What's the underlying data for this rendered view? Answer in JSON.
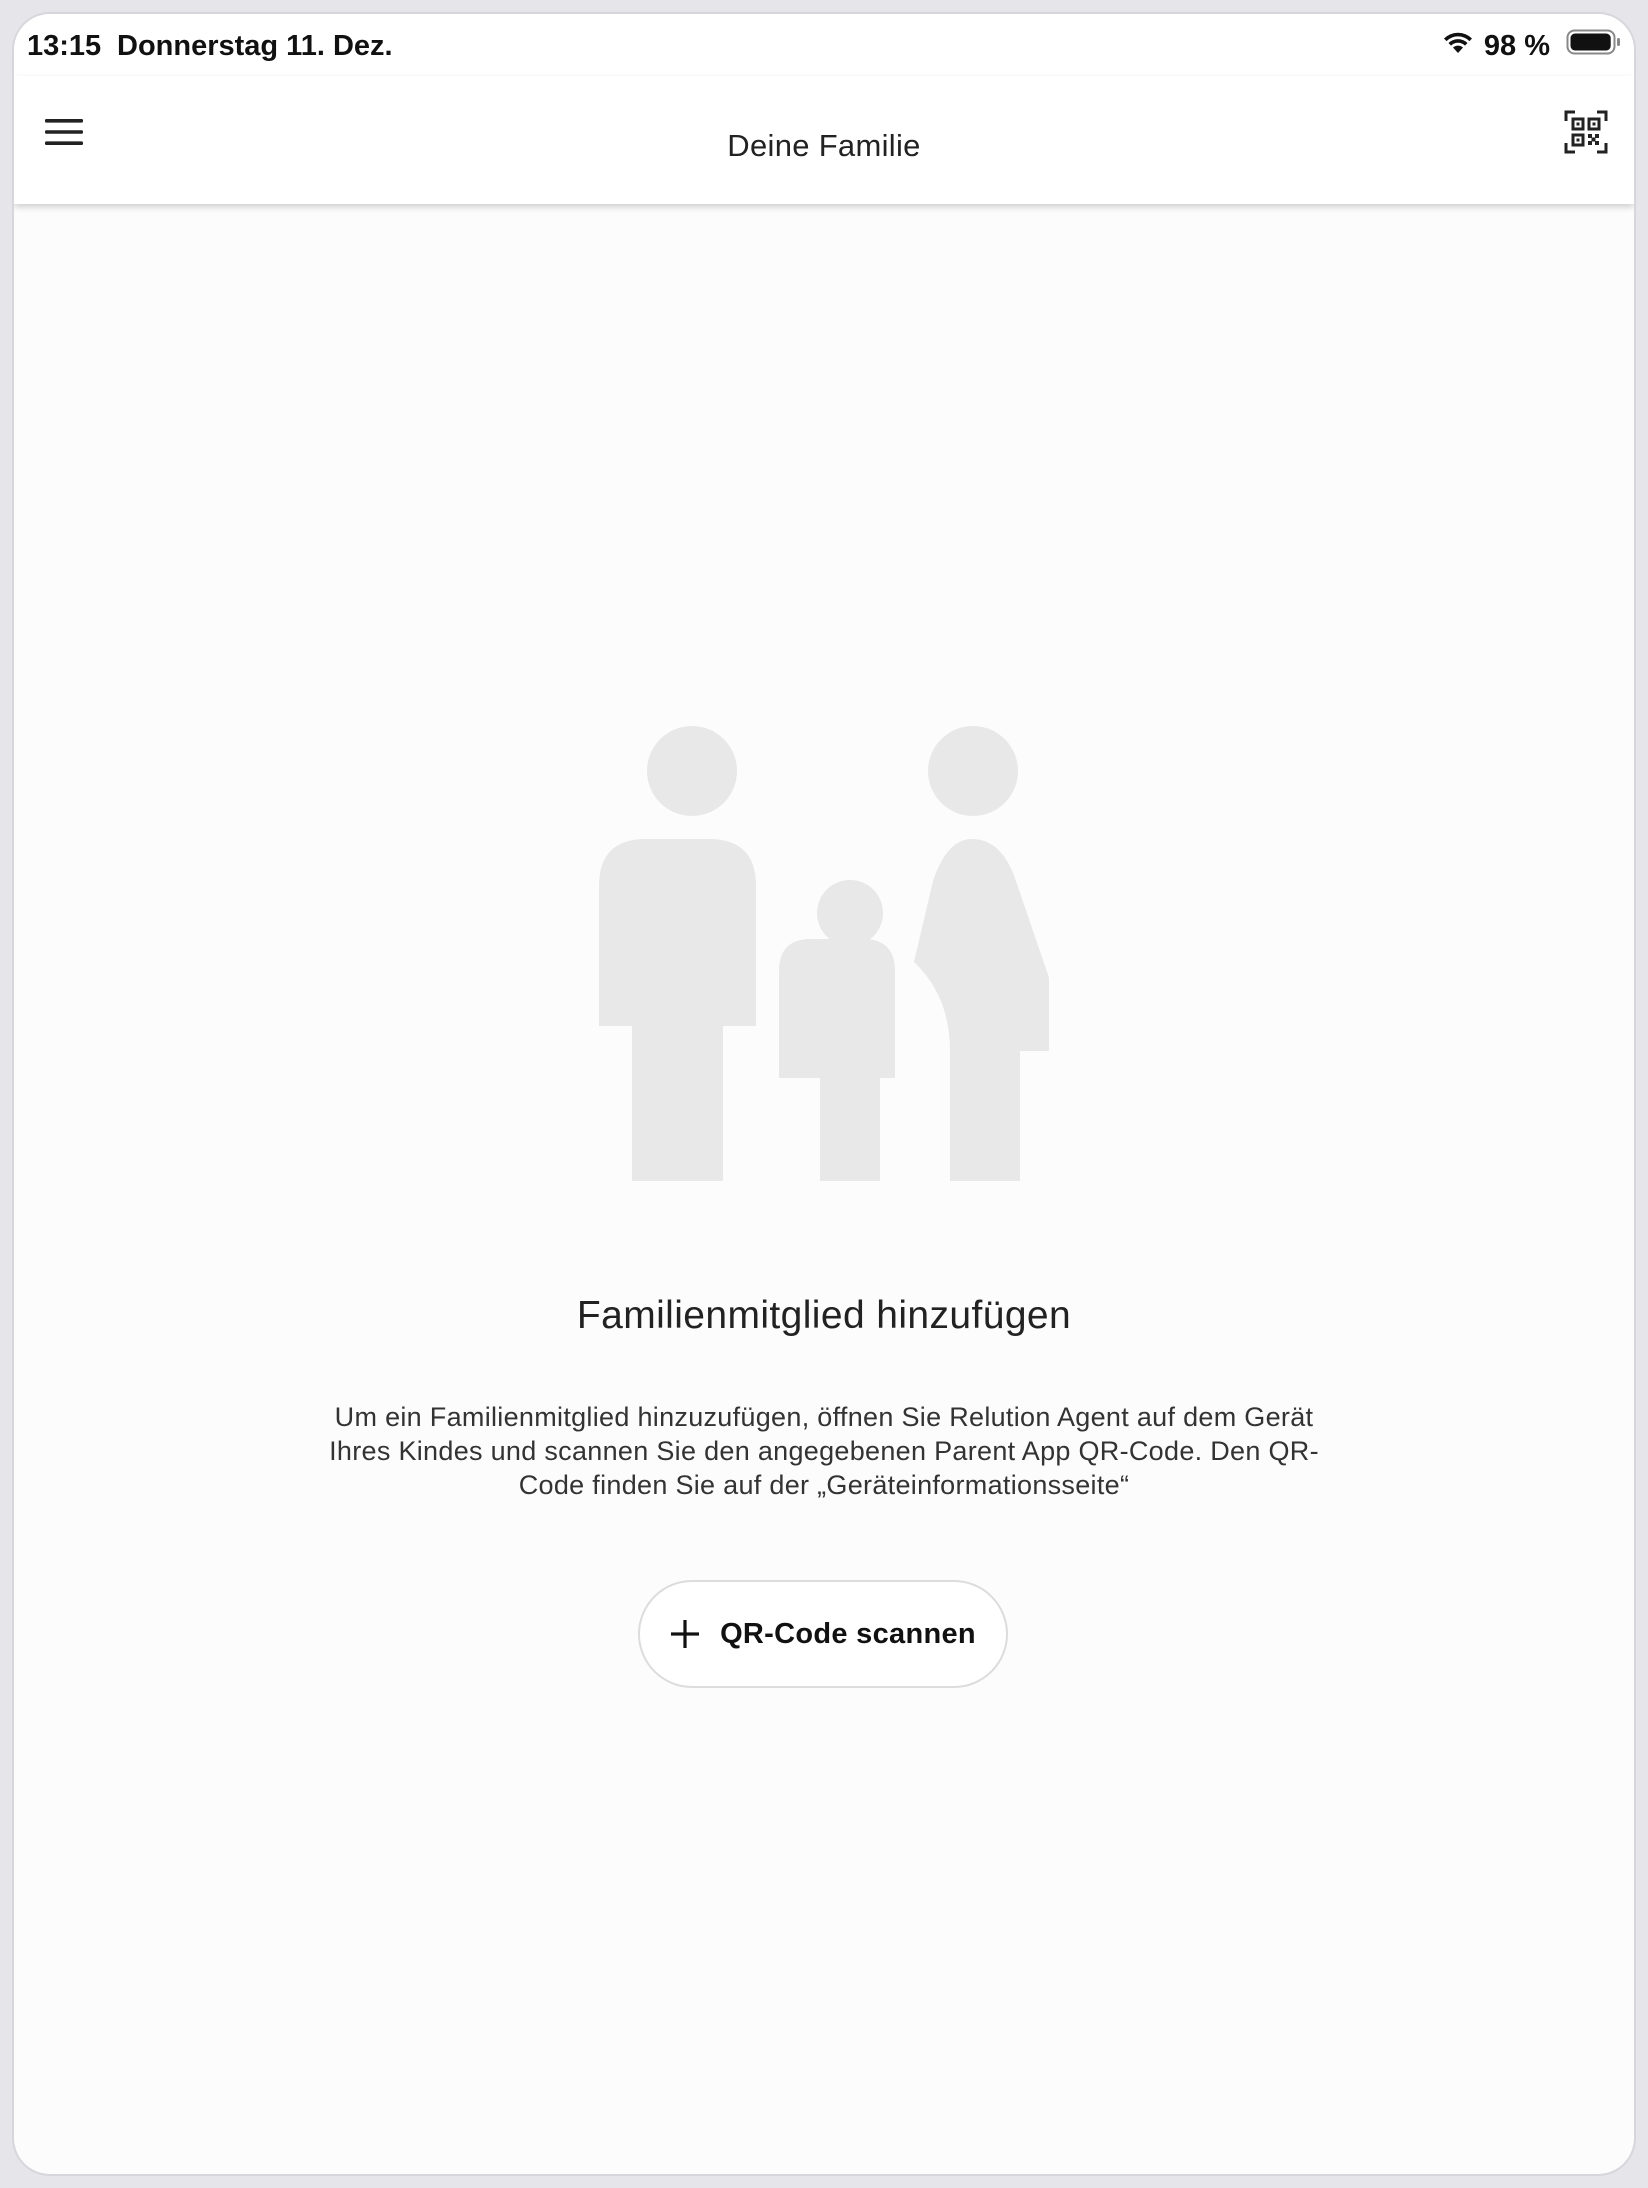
{
  "status_bar": {
    "time": "13:15",
    "date": "Donnerstag 11. Dez.",
    "battery_percent": "98 %",
    "wifi_icon": "wifi-icon",
    "battery_icon": "battery-icon",
    "battery_level": 0.98
  },
  "app_bar": {
    "title": "Deine Familie",
    "menu_icon": "hamburger-menu-icon",
    "qr_icon": "qr-scan-icon"
  },
  "empty_state": {
    "illustration_icon": "family-icon",
    "heading": "Familienmitglied hinzufügen",
    "description": "Um ein Familienmitglied hinzuzufügen, öffnen Sie Relution Agent auf dem Gerät Ihres Kindes und scannen Sie den angegebenen Parent App QR-Code. Den QR-Code finden Sie auf der „Geräteinformationsseite“",
    "button_label": "QR-Code scannen",
    "button_icon": "plus-icon"
  },
  "colors": {
    "illustration": "#e8e8e8",
    "background": "#fcfcfc",
    "text": "#222222",
    "button_border": "#dcdcdc"
  }
}
